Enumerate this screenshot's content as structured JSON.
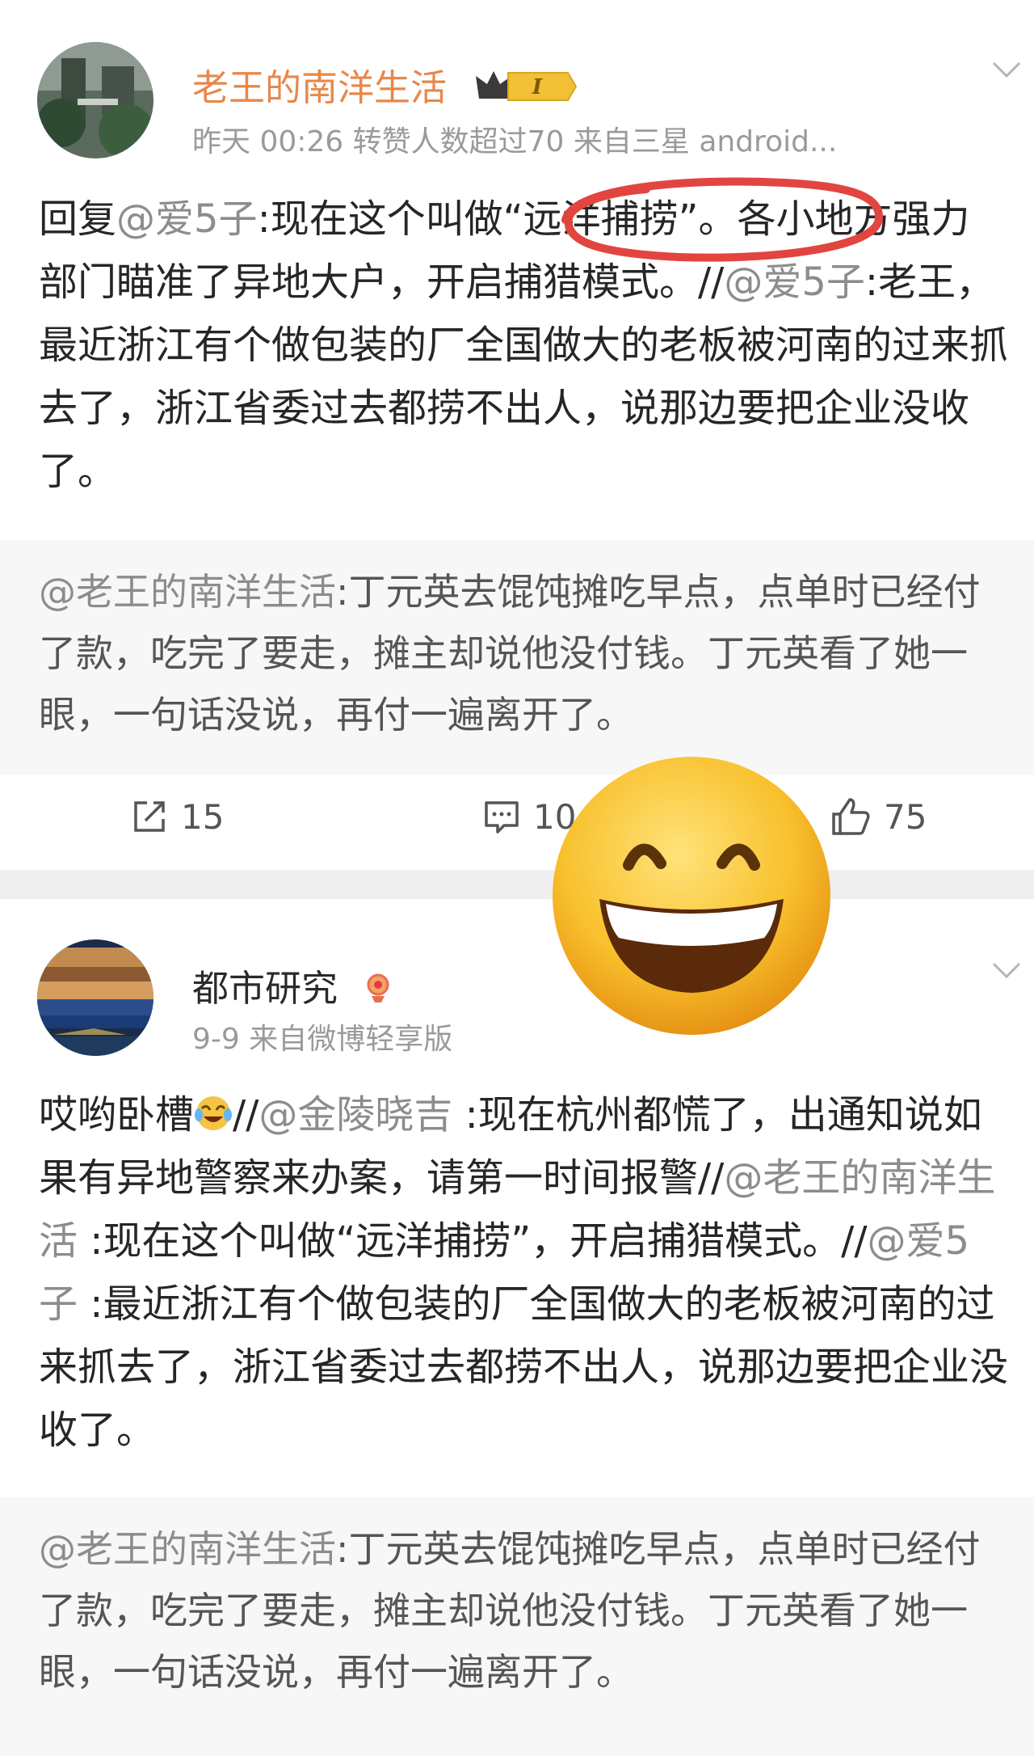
{
  "post1": {
    "username": "老王的南洋生活",
    "meta": "昨天 00:26 转赞人数超过70  来自三星 android...",
    "body": {
      "reply_prefix": "回复",
      "mention1": "@爱5子",
      "text1": ":现在这个叫做“远洋捕捞”。各小地方强力部门瞄准了异地大户，开启捕猎模式。//",
      "mention2": "@爱5子",
      "text2": ":老王，最近浙江有个做包装的厂全国做大的老板被河南的过来抓去了，浙江省委过去都捞不出人，说那边要把企业没收了。"
    },
    "repost": {
      "mention": "@老王的南洋生活",
      "text": ":丁元英去馄饨摊吃早点，点单时已经付了款，吃完了要走，摊主却说他没付钱。丁元英看了她一眼，一句话没说，再付一遍离开了。"
    },
    "actions": {
      "repost_count": "15",
      "comment_count": "10",
      "like_count": "75"
    }
  },
  "post2": {
    "username": "都市研究",
    "meta": "9-9  来自微博轻享版",
    "body": {
      "text1": "哎哟卧槽",
      "text2": "//",
      "mention1": "@金陵晓吉",
      "text3": " :现在杭州都慌了，出通知说如果有异地警察来办案，请第一时间报警//",
      "mention2": "@老王的南洋生活",
      "text4": " :现在这个叫做“远洋捕捞”，开启捕猎模式。//",
      "mention3": "@爱5子",
      "text5": " :最近浙江有个做包装的厂全国做大的老板被河南的过来抓去了，浙江省委过去都捞不出人，说那边要把企业没收了。"
    },
    "repost": {
      "mention": "@老王的南洋生活",
      "text": ":丁元英去馄饨摊吃早点，点单时已经付了款，吃完了要走，摊主却说他没付钱。丁元英看了她一眼，一句话没说，再付一遍离开了。"
    }
  },
  "icons": {
    "verified_badge": "crown-badge-icon",
    "more": "chevron-down-icon",
    "repost": "repost-icon",
    "comment": "comment-icon",
    "like": "thumbs-up-icon",
    "overlay": "grinning-emoji",
    "inline_emoji": "laughing-crying-emoji"
  },
  "colors": {
    "mention": "#8c8c8c",
    "highlight_stroke": "#e2453f",
    "badge_gold": "#f2c037",
    "separator": "#efefef"
  }
}
